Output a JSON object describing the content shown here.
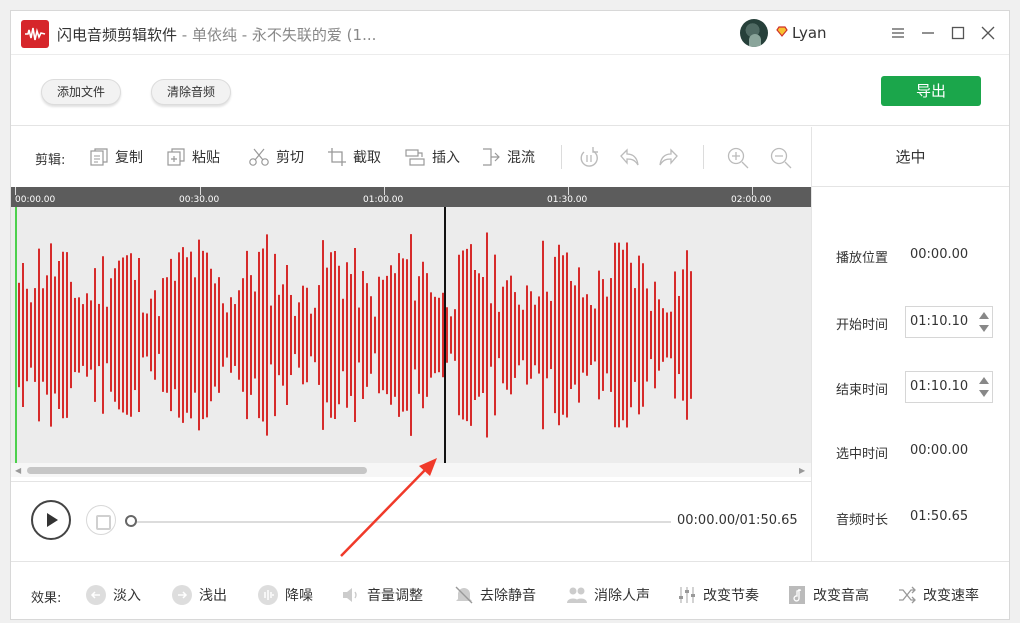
{
  "titlebar": {
    "app_name": "闪电音频剪辑软件",
    "file_title": " - 单依纯 - 永不失联的爱 (1...",
    "username": "Lyan"
  },
  "top_actions": {
    "add_file": "添加文件",
    "clear_audio": "清除音频",
    "export": "导出"
  },
  "edit_toolbar": {
    "label": "剪辑:",
    "copy": "复制",
    "paste": "粘贴",
    "cut": "剪切",
    "crop": "截取",
    "insert": "插入",
    "mix": "混流"
  },
  "timeline": {
    "ticks": [
      "00:00.00",
      "00:30.00",
      "01:00.00",
      "01:30.00",
      "02:00.00"
    ]
  },
  "selection_panel": {
    "header": "选中",
    "play_position_label": "播放位置",
    "play_position_value": "00:00.00",
    "start_time_label": "开始时间",
    "start_time_value": "01:10.10",
    "end_time_label": "结束时间",
    "end_time_value": "01:10.10",
    "selected_duration_label": "选中时间",
    "selected_duration_value": "00:00.00",
    "audio_duration_label": "音频时长",
    "audio_duration_value": "01:50.65"
  },
  "player": {
    "time": "00:00.00/01:50.65",
    "progress": 0
  },
  "effects": {
    "label": "效果:",
    "fade_in": "淡入",
    "fade_out": "浅出",
    "denoise": "降噪",
    "volume_adjust": "音量调整",
    "remove_silence": "去除静音",
    "remove_vocals": "消除人声",
    "change_tempo": "改变节奏",
    "change_pitch": "改变音高",
    "change_speed": "改变速率"
  },
  "colors": {
    "accent_green": "#1ba64b",
    "waveform": "#d62b2b",
    "logo_red": "#d6262b"
  }
}
